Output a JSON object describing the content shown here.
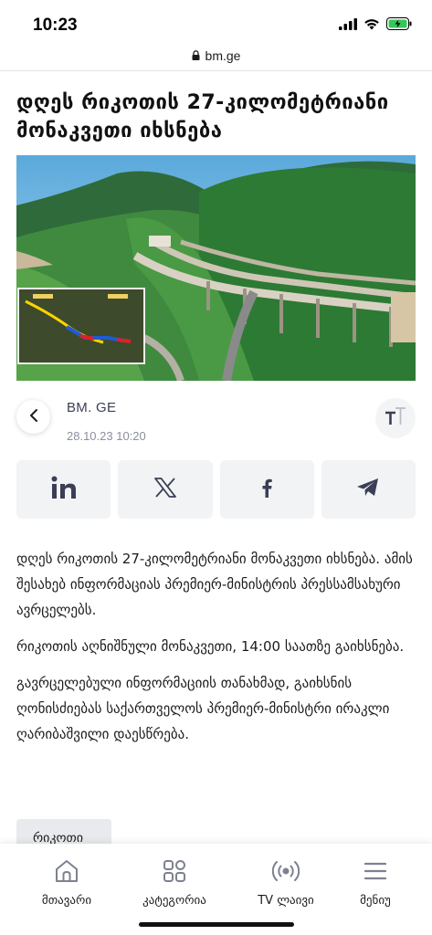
{
  "status_bar": {
    "time": "10:23",
    "icons": [
      "signal-icon",
      "wifi-icon",
      "battery-charging-icon"
    ],
    "url": "bm.ge"
  },
  "article": {
    "headline": "დღეს რიკოთის 27-კილომეტრიანი მონაკვეთი იხსნება",
    "source": "BM. GE",
    "date": "28.10.23 10:20",
    "paragraphs": [
      "დღეს რიკოთის 27-კილომეტრიანი მონაკვეთი იხსნება. ამის შესახებ ინფორმაციას პრემიერ-მინისტრის პრესსამსახური ავრცელებს.",
      "რიკოთის აღნიშნული მონაკვეთი, 14:00 საათზე გაიხსნება.",
      "გავრცელებული ინფორმაციის თანახმად, გაიხსნის ღონისძიებას საქართველოს პრემიერ-მინისტრი ირაკლი ღარიბაშვილი დაესწრება."
    ],
    "tag": "რიკოთი"
  },
  "share": [
    "linkedin-icon",
    "x-icon",
    "facebook-icon",
    "telegram-icon"
  ],
  "nav": {
    "items": [
      {
        "label": "მთავარი",
        "icon": "home-icon"
      },
      {
        "label": "კატეგორია",
        "icon": "grid-icon"
      },
      {
        "label": "TV ლაივი",
        "icon": "broadcast-icon"
      },
      {
        "label": "მენიუ",
        "icon": "menu-icon"
      }
    ]
  },
  "colors": {
    "accent_dark": "#3a3f55",
    "share_bg": "#f2f3f5",
    "tag_bg": "#e9eaee"
  }
}
